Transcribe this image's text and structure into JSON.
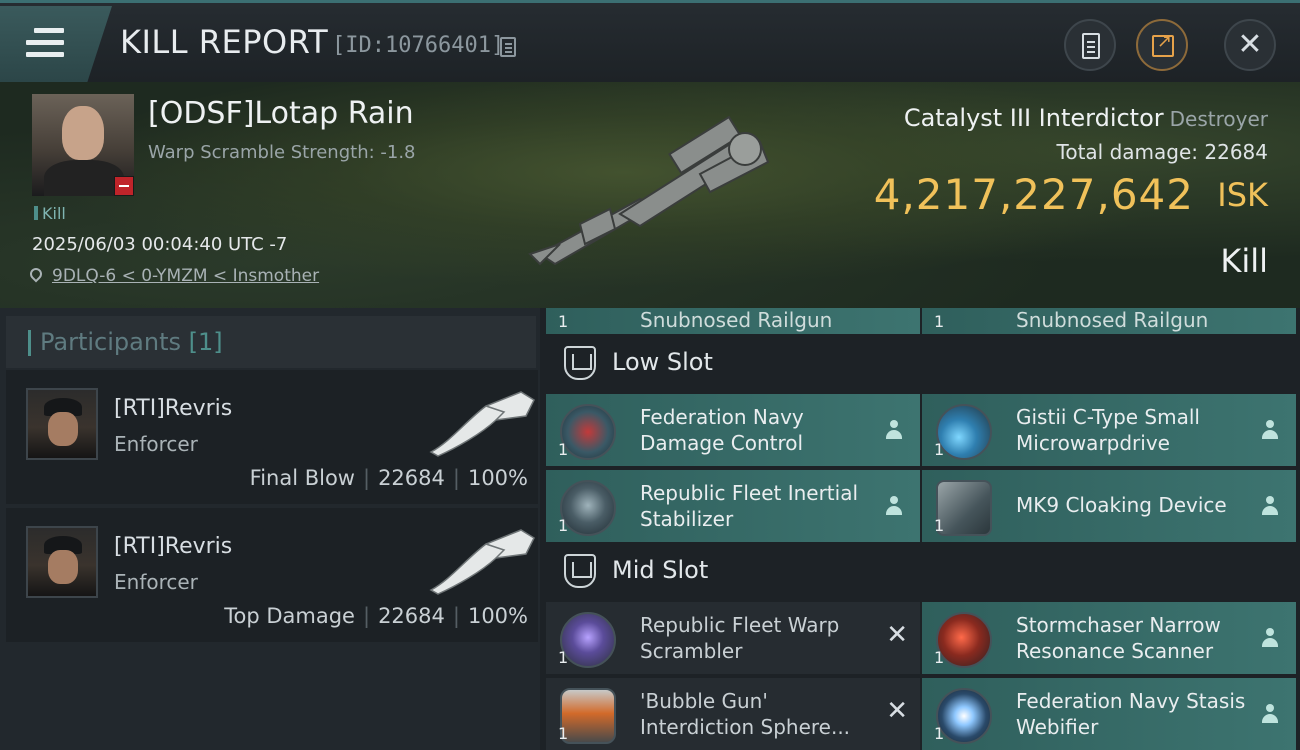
{
  "header": {
    "title": "KILL REPORT",
    "report_id": "[ID:10766401]"
  },
  "victim": {
    "name": "[ODSF]Lotap Rain",
    "warp_strength": "Warp Scramble Strength: -1.8",
    "tag": "Kill",
    "date": "2025/06/03 00:04:40 UTC -7",
    "location": "9DLQ-6 < 0-YMZM < Insmother",
    "ship_name": "Catalyst III Interdictor",
    "ship_class": "Destroyer",
    "total_damage": "Total damage:  22684",
    "isk_value": "4,217,227,642",
    "isk_unit": "ISK",
    "result": "Kill"
  },
  "participants": {
    "title": "Participants",
    "count": "[1]",
    "items": [
      {
        "name": "[RTI]Revris",
        "ship": "Enforcer",
        "role": "Final Blow",
        "damage": "22684",
        "percent": "100%"
      },
      {
        "name": "[RTI]Revris",
        "ship": "Enforcer",
        "role": "Top Damage",
        "damage": "22684",
        "percent": "100%"
      }
    ]
  },
  "fittings": {
    "top_partial": [
      {
        "qty": "1",
        "name": "Snubnosed Railgun"
      },
      {
        "qty": "1",
        "name": "Snubnosed Railgun"
      }
    ],
    "low_slot": {
      "label": "Low Slot",
      "modules": [
        {
          "qty": "1",
          "name": "Federation Navy Damage Control",
          "status": "destroyed"
        },
        {
          "qty": "1",
          "name": "Gistii C-Type Small Microwarpdrive",
          "status": "destroyed"
        },
        {
          "qty": "1",
          "name": "Republic Fleet Inertial Stabilizer",
          "status": "destroyed"
        },
        {
          "qty": "1",
          "name": "MK9 Cloaking Device",
          "status": "destroyed"
        }
      ]
    },
    "mid_slot": {
      "label": "Mid Slot",
      "modules": [
        {
          "qty": "1",
          "name": "Republic Fleet Warp Scrambler",
          "status": "dropped"
        },
        {
          "qty": "1",
          "name": "Stormchaser Narrow Resonance Scanner",
          "status": "destroyed"
        },
        {
          "qty": "1",
          "name": "'Bubble Gun' Interdiction Sphere...",
          "status": "dropped"
        },
        {
          "qty": "1",
          "name": "Federation Navy Stasis Webifier",
          "status": "destroyed"
        }
      ]
    }
  },
  "colors": {
    "isk": "#f0c15a",
    "fitted_row": "#3d7470",
    "accent": "#4e8f8b"
  }
}
